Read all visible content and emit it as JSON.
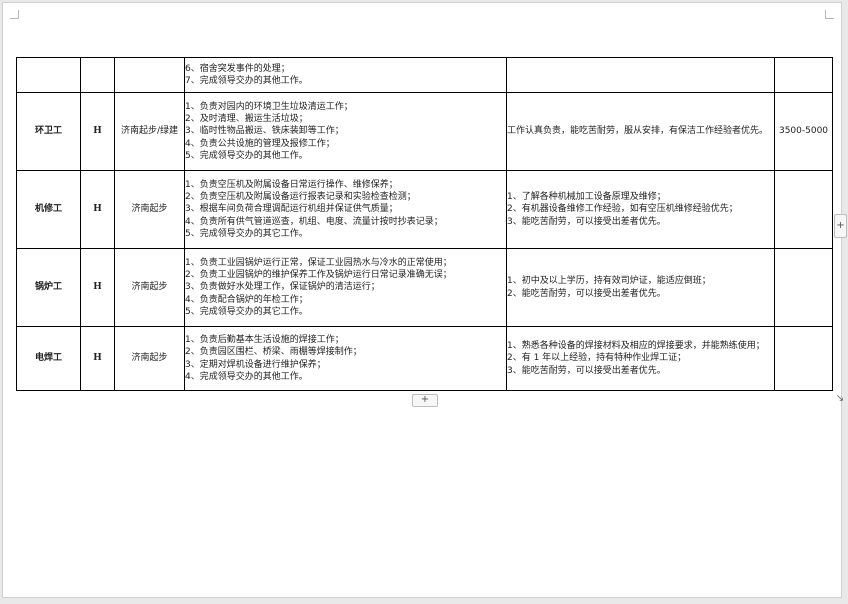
{
  "table": {
    "rows": [
      {
        "position": "",
        "level": "",
        "location": "",
        "duties": [
          "6、宿舍突发事件的处理；",
          "7、完成领导交办的其他工作。"
        ],
        "requirements": [
          ""
        ],
        "salary": ""
      },
      {
        "position": "环卫工",
        "level": "H",
        "location": "济南起步/绿建",
        "duties": [
          "1、负责对园内的环境卫生垃圾清运工作；",
          "2、及时清理、搬运生活垃圾；",
          "3、临时性物品搬运、铁床装卸等工作；",
          "4、负责公共设施的管理及报修工作；",
          "5、完成领导交办的其他工作。"
        ],
        "requirements": [
          "工作认真负责，能吃苦耐劳，服从安排，有保洁工作经验者优先。"
        ],
        "salary": "3500-5000"
      },
      {
        "position": "机修工",
        "level": "H",
        "location": "济南起步",
        "duties": [
          "1、负责空压机及附属设备日常运行操作、维修保养；",
          "2、负责空压机及附属设备运行报表记录和实验检查检测；",
          "3、根据车间负荷合理调配运行机组并保证供气质量；",
          "4、负责所有供气管道巡查，机组、电度、流量计按时抄表记录；",
          "5、完成领导交办的其它工作。"
        ],
        "requirements": [
          "1、了解各种机械加工设备原理及维修；",
          "2、有机器设备维修工作经验，如有空压机维修经验优先；",
          "3、能吃苦耐劳，可以接受出差者优先。"
        ],
        "salary": ""
      },
      {
        "position": "锅炉工",
        "level": "H",
        "location": "济南起步",
        "duties": [
          "1、负责工业园锅炉运行正常，保证工业园热水与冷水的正常使用；",
          "2、负责工业园锅炉的维护保养工作及锅炉运行日常记录准确无误；",
          "3、负责做好水处理工作，保证锅炉的清洁运行；",
          "4、负责配合锅炉的年检工作；",
          "5、完成领导交办的其它工作。"
        ],
        "requirements": [
          "1、初中及以上学历，持有效司炉证，能适应倒班；",
          "2、能吃苦耐劳，可以接受出差者优先。"
        ],
        "salary": ""
      },
      {
        "position": "电焊工",
        "level": "H",
        "location": "济南起步",
        "duties": [
          "1、负责后勤基本生活设施的焊接工作；",
          "2、负责园区围栏、桥梁、雨棚等焊接制作；",
          "3、定期对焊机设备进行维护保养；",
          "4、完成领导交办的其他工作。"
        ],
        "requirements": [
          "1、熟悉各种设备的焊接材料及相应的焊接要求，并能熟练使用；",
          "2、有 1 年以上经验，持有特种作业焊工证；",
          "3、能吃苦耐劳，可以接受出差者优先。"
        ],
        "salary": ""
      }
    ]
  },
  "controls": {
    "add_row": "+",
    "add_column": "+",
    "resize": "↘"
  }
}
